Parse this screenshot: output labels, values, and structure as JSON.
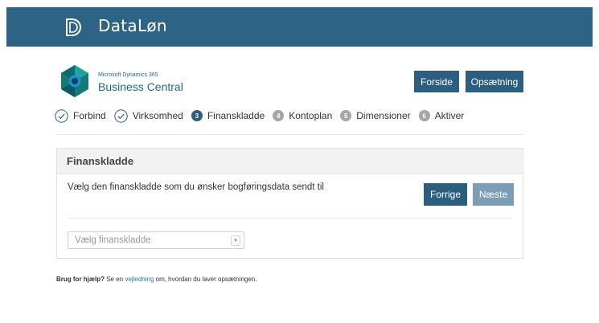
{
  "header": {
    "brand": "DataLøn",
    "logo_icon": "dataloen-d-icon"
  },
  "product": {
    "small": "Microsoft Dynamics 365",
    "name": "Business Central"
  },
  "nav": {
    "home_label": "Forside",
    "setup_label": "Opsætning"
  },
  "steps": [
    {
      "label": "Forbind",
      "state": "done"
    },
    {
      "label": "Virksomhed",
      "state": "done"
    },
    {
      "number": "3",
      "label": "Finanskladde",
      "state": "active"
    },
    {
      "number": "4",
      "label": "Kontoplan",
      "state": "pending"
    },
    {
      "number": "5",
      "label": "Dimensioner",
      "state": "pending"
    },
    {
      "number": "6",
      "label": "Aktiver",
      "state": "pending"
    }
  ],
  "panel": {
    "title": "Finanskladde",
    "description": "Vælg den finanskladde som du ønsker bogføringsdata sendt til",
    "prev_label": "Forrige",
    "next_label": "Næste",
    "select_placeholder": "Vælg finanskladde"
  },
  "help": {
    "bold": "Brug for hjælp?",
    "pre": " Se en ",
    "link": "vejledning",
    "post": " om, hvordan du laver opsætningen."
  },
  "colors": {
    "topbar": "#2d6486",
    "primary_button": "#2c5f7f",
    "disabled_button": "#7d9cb6",
    "link": "#2a73b5"
  }
}
